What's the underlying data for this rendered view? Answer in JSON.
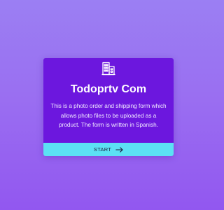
{
  "form": {
    "icon": "building-icon",
    "title": "Todoprtv Com",
    "description": "This is a photo order and shipping form which allows photo files to be uploaded as a product. The form is written in Spanish.",
    "start_label": "START",
    "start_icon": "arrow-right-icon"
  },
  "colors": {
    "background_top": "#9B7FF3",
    "background_bottom": "#9257F0",
    "card": "#6C17DE",
    "button": "#5CE1F4",
    "text": "#FFFFFF"
  }
}
